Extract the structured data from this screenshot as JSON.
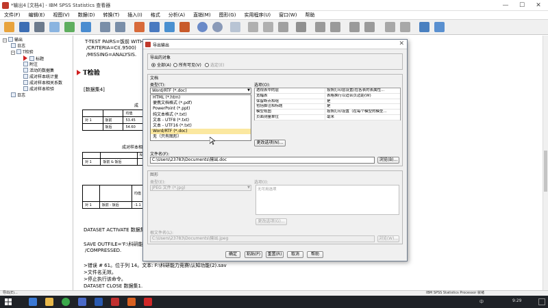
{
  "window": {
    "title": "*输出4 [文档4] - IBM SPSS Statistics 查看器",
    "controls": [
      "—",
      "☐",
      "✕"
    ]
  },
  "menu": [
    "文件(F)",
    "编辑(E)",
    "视图(V)",
    "数据(D)",
    "转换(T)",
    "插入(I)",
    "格式",
    "分析(A)",
    "直销(M)",
    "图形(G)",
    "实用程序(U)",
    "窗口(W)",
    "帮助"
  ],
  "outline": [
    {
      "label": "输出",
      "level": 0,
      "exp": "−"
    },
    {
      "label": "日志",
      "level": 1,
      "exp": ""
    },
    {
      "label": "T检验",
      "level": 1,
      "exp": "−"
    },
    {
      "label": "标题",
      "level": 2,
      "exp": ""
    },
    {
      "label": "附注",
      "level": 2,
      "exp": ""
    },
    {
      "label": "活动的数据集",
      "level": 2,
      "exp": ""
    },
    {
      "label": "成对样本统计量",
      "level": 2,
      "exp": ""
    },
    {
      "label": "成对样本相关系数",
      "level": 2,
      "exp": ""
    },
    {
      "label": "成对样本检验",
      "level": 2,
      "exp": ""
    },
    {
      "label": "日志",
      "level": 1,
      "exp": ""
    }
  ],
  "content": {
    "syntax_lines": [
      "T-TEST PAIRS=饭前 WITH",
      "/CRITERIA=CI(.9500)",
      "/MISSING=ANALYSIS."
    ],
    "heading": "T检验",
    "dataset": "[数据集4]",
    "stats_title": "成",
    "stats_table": {
      "header": [
        "",
        "",
        "均值",
        "N"
      ],
      "rows": [
        [
          "对 1",
          "饭前",
          "53.45",
          ""
        ],
        [
          "",
          "饭后",
          "54.60",
          ""
        ]
      ]
    },
    "corr_title": "成对样本相",
    "corr_table": {
      "header": [
        "",
        "",
        "N"
      ],
      "rows": [
        [
          "对 1",
          "饭前 & 饭后",
          ""
        ]
      ]
    },
    "test_table": {
      "header": [
        "",
        "",
        "均值"
      ],
      "rows": [
        [
          "对 1",
          "饭前 - 饭后",
          "-1.1"
        ]
      ]
    },
    "after_lines": [
      "DATASET ACTIVATE 数据集",
      "SAVE OUTFILE='F:\\科研能",
      "/COMPRESSED.",
      ">错误 # 61。位于列 14。文本: F:\\科研能力竞赛\\认知功能(2).sav",
      ">文件名无效。",
      ">停止执行该命令。",
      "DATASET CLOSE 数据集1."
    ]
  },
  "dialog": {
    "title": "导出输出",
    "objects_group": "导出的对象",
    "radios": [
      {
        "label": "全部(A)",
        "checked": true,
        "disabled": false
      },
      {
        "label": "所有可见(V)",
        "checked": false,
        "disabled": false
      },
      {
        "label": "选定(E)",
        "checked": false,
        "disabled": true
      }
    ],
    "doc_group": "文档",
    "type_label": "类型(T):",
    "type_value": "Word/RTF (*.doc)",
    "type_options": [
      "HTML (*.htm)",
      "便携文档格式 (*.pdf)",
      "PowerPoint (*.ppt)",
      "纯文本格式 (*.txt)",
      "文本 - UTF8 (*.txt)",
      "文本 - UTF16 (*.txt)",
      "Word/RTF (*.doc)",
      "无（只有图形）"
    ],
    "selected_option_index": 6,
    "options_label": "选项(O):",
    "options": [
      [
        "透视表中的层",
        "按照打印层设置(在各表的表属性..."
      ],
      [
        "宽幅表",
        "表格换行以适合页边距(W)"
      ],
      [
        "保留断点和组",
        "是"
      ],
      [
        "包括脚注和标题",
        "是"
      ],
      [
        "模型视图",
        "按照打印设置（在每个模型的模型..."
      ],
      [
        "页面测量单位",
        "毫米"
      ]
    ],
    "change_options_btn": "更改选项(N)...",
    "filename_label": "文件名(F):",
    "filename_value": "C:\\Users\\23783\\Documents\\输出.doc",
    "browse_btn": "浏览(B)...",
    "graphics_group": "图形",
    "g_type_label": "类型(E):",
    "g_type_value": "JPEG 文件 (*.jpg)",
    "g_options_label": "选项(I):",
    "g_options_value": "无可用选项",
    "g_change_btn": "更改选项(G)...",
    "g_root_label": "根文件名(L):",
    "g_root_value": "C:\\Users\\23783\\Documents\\输出.jpeg",
    "g_browse_btn": "浏览(W)...",
    "buttons": [
      "确定",
      "粘贴(P)",
      "重置(R)",
      "取消",
      "帮助"
    ]
  },
  "statusbar": {
    "left": "导出(E)...",
    "right": "IBM SPSS Statistics Processor 就绪"
  },
  "taskbar": {
    "time": "9:29",
    "date": "",
    "tray": "中"
  },
  "colors": {
    "accent": "#d02020",
    "dialog_bg": "#f0f0f0",
    "selection": "#fbe8a0",
    "taskbar": "#1f2227"
  }
}
